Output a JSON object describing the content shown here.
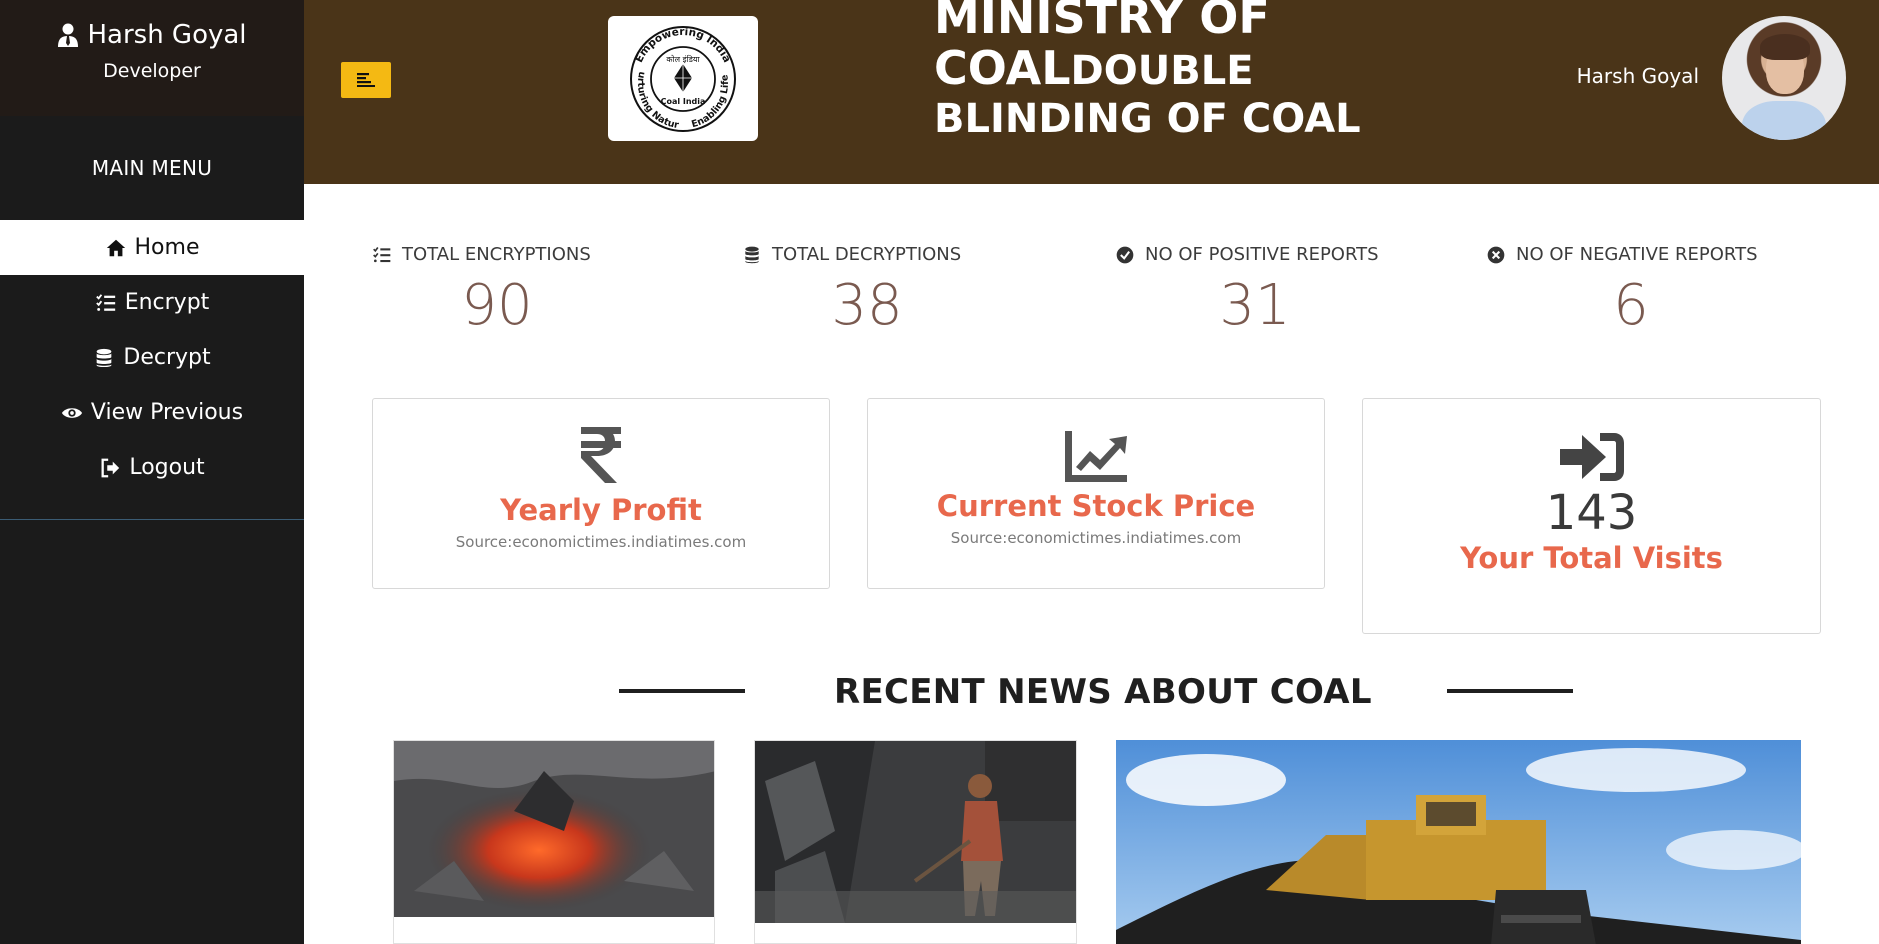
{
  "sidebar": {
    "user_name": "Harsh Goyal",
    "user_role": "Developer",
    "menu_title": "MAIN MENU",
    "items": [
      {
        "label": "Home",
        "icon": "home-icon",
        "active": true
      },
      {
        "label": "Encrypt",
        "icon": "list-check-icon",
        "active": false
      },
      {
        "label": "Decrypt",
        "icon": "database-icon",
        "active": false
      },
      {
        "label": "View Previous",
        "icon": "eye-icon",
        "active": false
      },
      {
        "label": "Logout",
        "icon": "logout-icon",
        "active": false
      }
    ]
  },
  "header": {
    "title_line1": "MINISTRY OF",
    "title_line2a": "COAL",
    "title_line2b": "DOUBLE",
    "title_line3": "BLINDING OF COAL",
    "user_name": "Harsh Goyal",
    "logo_text_top": "Empowering India",
    "logo_text_left": "Nurturing Nature",
    "logo_text_right": "Enabling Life",
    "logo_text_center": "Coal India",
    "logo_text_hindi": "कोल इंडिया"
  },
  "stats": [
    {
      "label": "TOTAL ENCRYPTIONS",
      "value": "90",
      "icon": "list-check-icon"
    },
    {
      "label": "TOTAL DECRYPTIONS",
      "value": "38",
      "icon": "database-icon"
    },
    {
      "label": "NO OF POSITIVE REPORTS",
      "value": "31",
      "icon": "check-circle-icon"
    },
    {
      "label": "NO OF NEGATIVE REPORTS",
      "value": "6",
      "icon": "x-circle-icon"
    }
  ],
  "cards": {
    "profit": {
      "title": "Yearly Profit",
      "source": "Source:economictimes.indiatimes.com",
      "icon": "rupee-icon"
    },
    "stock": {
      "title": "Current Stock Price",
      "source": "Source:economictimes.indiatimes.com",
      "icon": "chart-line-icon"
    },
    "visits": {
      "value": "143",
      "title": "Your Total Visits",
      "icon": "sign-in-icon"
    }
  },
  "news": {
    "title": "RECENT NEWS ABOUT COAL"
  },
  "colors": {
    "sidebar_bg": "#1b1b1b",
    "header_bg": "#4a3418",
    "accent": "#f4b913",
    "card_title": "#e8684c",
    "stat_value": "#7a5a50"
  }
}
